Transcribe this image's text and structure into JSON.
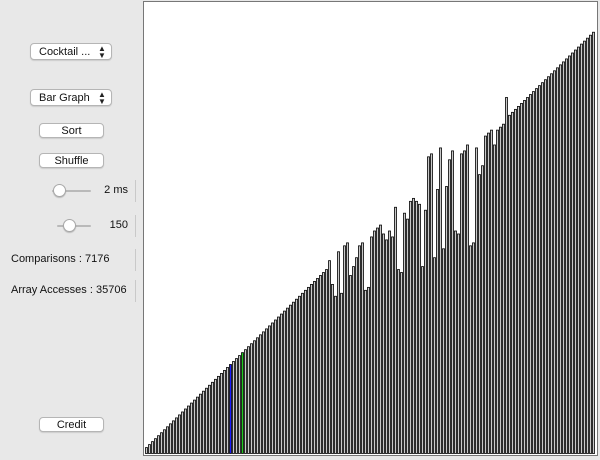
{
  "sidebar": {
    "algorithm_select": {
      "value": "Cocktail ..."
    },
    "view_select": {
      "value": "Bar Graph"
    },
    "sort_label": "Sort",
    "shuffle_label": "Shuffle",
    "delay_slider": {
      "value_text": "2 ms",
      "level": 0.05
    },
    "size_slider": {
      "value_text": "150",
      "level": 0.3
    },
    "comparisons_text": "Comparisons : 7176",
    "array_accesses_text": "Array Accesses : 35706",
    "credit_label": "Credit"
  },
  "visual": {
    "bar_fill": "#c9c9c9",
    "bar_stroke": "#000000",
    "highlight_blue": "#1a1aff",
    "highlight_green": "#1ec81e",
    "max_value": 150,
    "values": [
      2,
      3,
      4,
      5,
      6,
      7,
      8,
      9,
      10,
      11,
      12,
      13,
      14,
      15,
      16,
      17,
      18,
      19,
      20,
      21,
      22,
      23,
      24,
      25,
      26,
      27,
      28,
      29,
      30,
      31,
      32,
      33,
      34,
      35,
      36,
      37,
      38,
      39,
      40,
      41,
      42,
      43,
      44,
      45,
      46,
      47,
      48,
      49,
      50,
      51,
      52,
      53,
      54,
      55,
      56,
      57,
      58,
      59,
      60,
      61,
      62,
      65,
      57,
      53,
      68,
      54,
      70,
      71,
      60,
      63,
      66,
      70,
      71,
      55,
      56,
      73,
      75,
      76,
      77,
      74,
      72,
      75,
      73,
      83,
      62,
      61,
      81,
      79,
      85,
      86,
      85,
      84,
      63,
      82,
      100,
      101,
      66,
      89,
      103,
      69,
      90,
      99,
      102,
      75,
      74,
      101,
      102,
      104,
      70,
      71,
      103,
      94,
      97,
      107,
      108,
      109,
      104,
      109,
      110,
      111,
      120,
      114,
      115,
      116,
      117,
      118,
      119,
      120,
      121,
      122,
      123,
      124,
      125,
      126,
      127,
      128,
      129,
      130,
      131,
      132,
      133,
      134,
      135,
      136,
      137,
      138,
      139,
      140,
      141,
      142
    ],
    "blue_indices": [
      28
    ],
    "green_indices": [
      32
    ]
  }
}
